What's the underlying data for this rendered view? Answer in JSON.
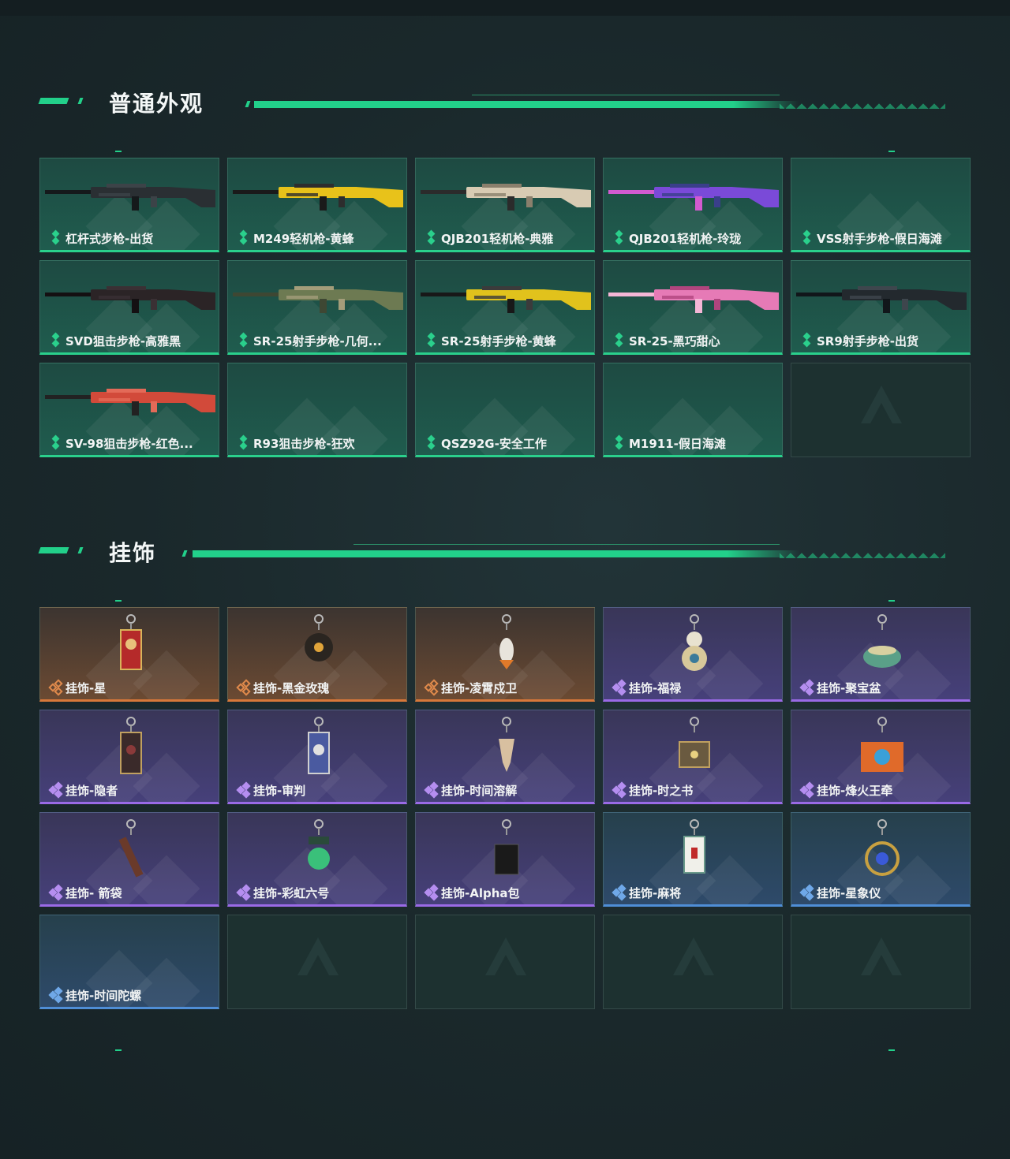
{
  "sections": [
    {
      "title": "普通外观",
      "items": [
        {
          "label": "杠杆式步枪-出货",
          "rarity": "green",
          "art": "rifle-dark"
        },
        {
          "label": "M249轻机枪-黄蜂",
          "rarity": "green",
          "art": "lmg-yellow"
        },
        {
          "label": "QJB201轻机枪-典雅",
          "rarity": "green",
          "art": "lmg-tan"
        },
        {
          "label": "QJB201轻机枪-玲珑",
          "rarity": "green",
          "art": "lmg-purple"
        },
        {
          "label": "VSS射手步枪-假日海滩",
          "rarity": "green",
          "art": ""
        },
        {
          "label": "SVD狙击步枪-高雅黑",
          "rarity": "green",
          "art": "sniper-dark"
        },
        {
          "label": "SR-25射手步枪-几何...",
          "rarity": "green",
          "art": "rifle-camo"
        },
        {
          "label": "SR-25射手步枪-黄蜂",
          "rarity": "green",
          "art": "rifle-yellow"
        },
        {
          "label": "SR-25-黑巧甜心",
          "rarity": "green",
          "art": "rifle-pink"
        },
        {
          "label": "SR9射手步枪-出货",
          "rarity": "green",
          "art": "rifle-dark2"
        },
        {
          "label": "SV-98狙击步枪-红色...",
          "rarity": "green",
          "art": "sniper-red"
        },
        {
          "label": "R93狙击步枪-狂欢",
          "rarity": "green",
          "art": ""
        },
        {
          "label": "QSZ92G-安全工作",
          "rarity": "green",
          "art": ""
        },
        {
          "label": "M1911-假日海滩",
          "rarity": "green",
          "art": ""
        },
        {
          "label": "",
          "rarity": "empty",
          "art": ""
        }
      ]
    },
    {
      "title": "挂饰",
      "items": [
        {
          "label": "挂饰-星",
          "rarity": "orange",
          "art": "tarot-red"
        },
        {
          "label": "挂饰-黑金玫瑰",
          "rarity": "orange",
          "art": "orb-dark"
        },
        {
          "label": "挂饰-凌霄戍卫",
          "rarity": "orange",
          "art": "rocket"
        },
        {
          "label": "挂饰-福禄",
          "rarity": "purple",
          "art": "gourd"
        },
        {
          "label": "挂饰-聚宝盆",
          "rarity": "purple",
          "art": "pot"
        },
        {
          "label": "挂饰-隐者",
          "rarity": "purple",
          "art": "tarot-dark"
        },
        {
          "label": "挂饰-审判",
          "rarity": "purple",
          "art": "tarot-blue"
        },
        {
          "label": "挂饰-时间溶解",
          "rarity": "purple",
          "art": "melt"
        },
        {
          "label": "挂饰-时之书",
          "rarity": "purple",
          "art": "book"
        },
        {
          "label": "挂饰-烽火王牵",
          "rarity": "purple",
          "art": "container"
        },
        {
          "label": "挂饰- 箭袋",
          "rarity": "purple",
          "art": "quiver"
        },
        {
          "label": "挂饰-彩虹六号",
          "rarity": "purple",
          "art": "six"
        },
        {
          "label": "挂饰-Alpha包",
          "rarity": "purple",
          "art": "bag"
        },
        {
          "label": "挂饰-麻将",
          "rarity": "blue",
          "art": "mahjong"
        },
        {
          "label": "挂饰-星象仪",
          "rarity": "blue",
          "art": "astrolabe"
        },
        {
          "label": "挂饰-时间陀螺",
          "rarity": "blue",
          "art": ""
        },
        {
          "label": "",
          "rarity": "empty",
          "art": ""
        },
        {
          "label": "",
          "rarity": "empty",
          "art": ""
        },
        {
          "label": "",
          "rarity": "empty",
          "art": ""
        },
        {
          "label": "",
          "rarity": "empty",
          "art": ""
        }
      ]
    }
  ],
  "colors": {
    "accent": "#22d08a",
    "green": "#2ad08c",
    "orange": "#d8783a",
    "purple": "#9a6ae6",
    "blue": "#4f8ed6"
  }
}
